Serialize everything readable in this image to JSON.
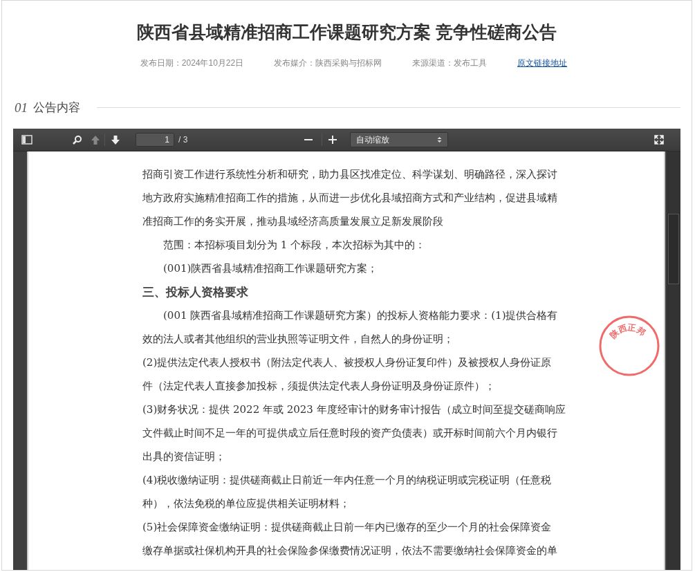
{
  "title": "陕西省县域精准招商工作课题研究方案 竞争性磋商公告",
  "meta": [
    {
      "kind": "text",
      "text": "发布日期：2024年10月22日"
    },
    {
      "kind": "text",
      "text": "发布媒介：陕西采购与招标网"
    },
    {
      "kind": "text",
      "text": "来源渠道：发布工具"
    },
    {
      "kind": "link",
      "text": "原文链接地址"
    }
  ],
  "section": {
    "number": "01",
    "label": "公告内容"
  },
  "viewer": {
    "page_input": "1",
    "page_count": "/ 3",
    "zoom": "自动缩放",
    "lines": [
      {
        "kind": "text",
        "text": "招商引资工作进行系统性分析和研究，助力县区找准定位、科学谋划、明确路径，深入探讨"
      },
      {
        "kind": "text",
        "text": "地方政府实施精准招商工作的措施，从而进一步优化县域招商方式和产业结构，促进县域精"
      },
      {
        "kind": "text",
        "text": "准招商工作的务实开展，推动县域经济高质量发展立足新发展阶段"
      },
      {
        "kind": "indent",
        "text": "范围：本招标项目划分为 1 个标段，本次招标为其中的："
      },
      {
        "kind": "indent",
        "text": "(001)陕西省县域精准招商工作课题研究方案；"
      },
      {
        "kind": "heading",
        "text": "三、投标人资格要求"
      },
      {
        "kind": "indent",
        "text": "(001 陕西省县域精准招商工作课题研究方案）的投标人资格能力要求：(1)提供合格有"
      },
      {
        "kind": "text",
        "text": "效的法人或者其他组织的营业执照等证明文件，自然人的身份证明；"
      },
      {
        "kind": "text",
        "text": "(2)提供法定代表人授权书（附法定代表人、被授权人身份证复印件）及被授权人身份证原"
      },
      {
        "kind": "text",
        "text": "件（法定代表人直接参加投标，须提供法定代表人身份证明及身份证原件）；"
      },
      {
        "kind": "text",
        "text": "(3)财务状况：提供 2022 年或 2023 年度经审计的财务审计报告（成立时间至提交磋商响应"
      },
      {
        "kind": "text",
        "text": "文件截止时间不足一年的可提供成立后任意时段的资产负债表）或开标时间前六个月内银行"
      },
      {
        "kind": "text",
        "text": "出具的资信证明；"
      },
      {
        "kind": "text",
        "text": "(4)税收缴纳证明：提供磋商截止日前近一年内任意一个月的纳税证明或完税证明（任意税"
      },
      {
        "kind": "text",
        "text": "种），依法免税的单位应提供相关证明材料；"
      },
      {
        "kind": "text",
        "text": "(5)社会保障资金缴纳证明：提供磋商截止日前一年内已缴存的至少一个月的社会保障资金"
      },
      {
        "kind": "text",
        "text": "缴存单据或社保机构开具的社会保险参保缴费情况证明，依法不需要缴纳社会保障资金的单"
      }
    ],
    "stamp": "陕西正邦"
  }
}
